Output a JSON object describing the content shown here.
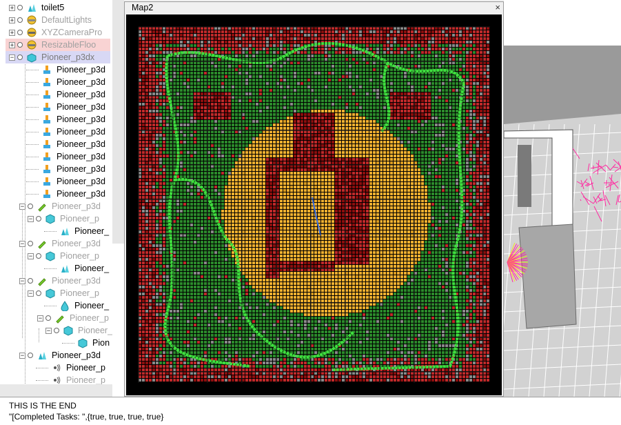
{
  "scene_tree": {
    "items": [
      {
        "label": "toilet5",
        "style": "normal",
        "icon": "shape-icon"
      },
      {
        "label": "DefaultLights",
        "style": "dim",
        "icon": "light-icon"
      },
      {
        "label": "XYZCameraPro",
        "style": "dim",
        "icon": "camera-icon"
      },
      {
        "label": "ResizableFloo",
        "style": "dim",
        "icon": "floor-icon"
      },
      {
        "label": "Pioneer_p3dx",
        "style": "selected",
        "icon": "robot-icon"
      },
      {
        "label": "Pioneer_p3d",
        "style": "normal",
        "icon": "joint-icon"
      },
      {
        "label": "Pioneer_p3d",
        "style": "normal",
        "icon": "joint-icon"
      },
      {
        "label": "Pioneer_p3d",
        "style": "normal",
        "icon": "joint-icon"
      },
      {
        "label": "Pioneer_p3d",
        "style": "normal",
        "icon": "joint-icon"
      },
      {
        "label": "Pioneer_p3d",
        "style": "normal",
        "icon": "joint-icon"
      },
      {
        "label": "Pioneer_p3d",
        "style": "normal",
        "icon": "joint-icon"
      },
      {
        "label": "Pioneer_p3d",
        "style": "normal",
        "icon": "joint-icon"
      },
      {
        "label": "Pioneer_p3d",
        "style": "normal",
        "icon": "joint-icon"
      },
      {
        "label": "Pioneer_p3d",
        "style": "normal",
        "icon": "joint-icon"
      },
      {
        "label": "Pioneer_p3d",
        "style": "normal",
        "icon": "joint-icon"
      },
      {
        "label": "Pioneer_p3d",
        "style": "normal",
        "icon": "joint-icon"
      },
      {
        "label": "Pioneer_p3d",
        "style": "dim",
        "icon": "motor-icon"
      },
      {
        "label": "Pioneer_p",
        "style": "dim",
        "icon": "cube-icon"
      },
      {
        "label": "Pioneer_",
        "style": "normal",
        "icon": "shape-icon"
      },
      {
        "label": "Pioneer_p3d",
        "style": "dim",
        "icon": "motor-icon"
      },
      {
        "label": "Pioneer_p",
        "style": "dim",
        "icon": "cube-icon"
      },
      {
        "label": "Pioneer_",
        "style": "normal",
        "icon": "shape-icon"
      },
      {
        "label": "Pioneer_p3d",
        "style": "dim",
        "icon": "motor-icon"
      },
      {
        "label": "Pioneer_p",
        "style": "dim",
        "icon": "cube-icon"
      },
      {
        "label": "Pioneer_",
        "style": "normal",
        "icon": "drop-icon"
      },
      {
        "label": "Pioneer_p",
        "style": "dim",
        "icon": "motor-icon"
      },
      {
        "label": "Pioneer_",
        "style": "dim",
        "icon": "cube-icon"
      },
      {
        "label": "Pion",
        "style": "normal",
        "icon": "cube-icon"
      },
      {
        "label": "Pioneer_p3d",
        "style": "normal",
        "icon": "shape-icon"
      },
      {
        "label": "Pioneer_p",
        "style": "normal",
        "icon": "sensor-icon"
      },
      {
        "label": "Pioneer_p",
        "style": "dim",
        "icon": "sensor-icon"
      }
    ]
  },
  "map_window": {
    "title": "Map2",
    "close_label": "×"
  },
  "console": {
    "lines": [
      "THIS IS THE END",
      "\"[Completed Tasks: \",{true, true, true, true}"
    ]
  },
  "colors": {
    "wall": "#8b0d0d",
    "obstacle": "#c0292a",
    "free": "#2b8a2b",
    "path": "#3ee03e",
    "unknown": "#8a8a8a",
    "range": "#f0b030"
  }
}
